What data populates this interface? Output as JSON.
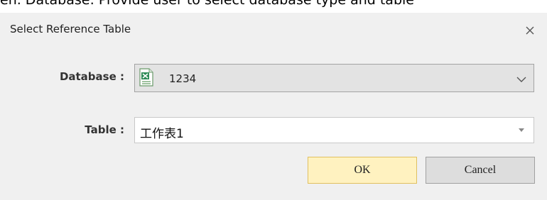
{
  "background": {
    "text": "en. Database: Provide user to select database type and table"
  },
  "dialog": {
    "title": "Select Reference Table",
    "close_icon": "close-icon",
    "database": {
      "label": "Database :",
      "value": "1234",
      "icon": "excel-file-icon"
    },
    "table": {
      "label": "Table :",
      "value": "工作表1"
    },
    "buttons": {
      "ok": "OK",
      "cancel": "Cancel"
    }
  },
  "colors": {
    "ok_button": "#fff2c0",
    "cancel_button": "#dddddd",
    "dialog_background": "#f0f0f0"
  }
}
